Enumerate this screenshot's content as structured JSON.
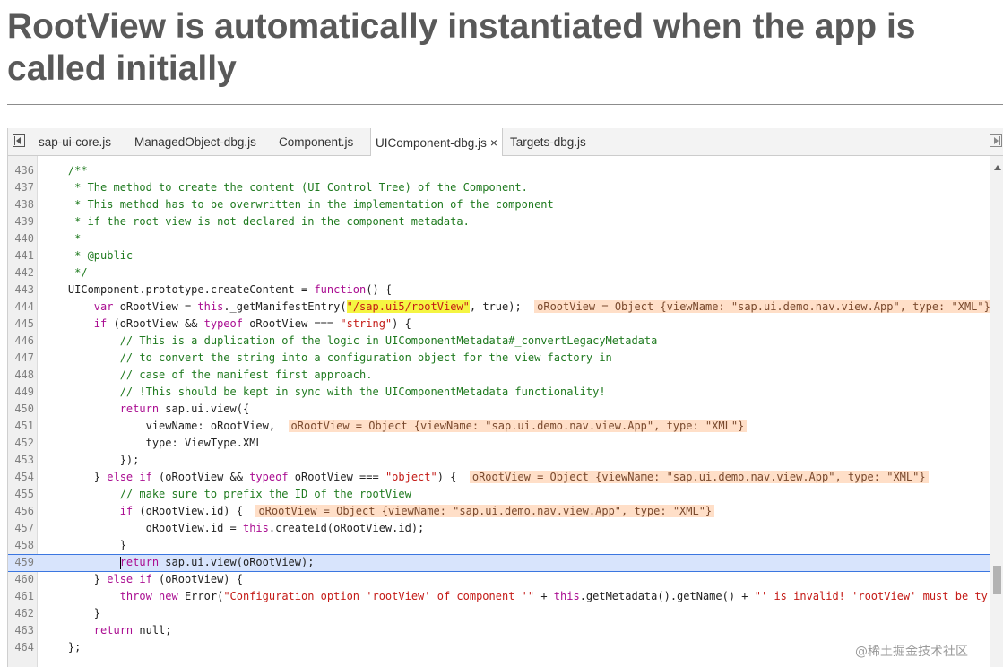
{
  "slide": {
    "title": "RootView is automatically instantiated when the app is called initially"
  },
  "tabs": [
    {
      "label": "sap-ui-core.js",
      "active": false
    },
    {
      "label": "ManagedObject-dbg.js",
      "active": false
    },
    {
      "label": "Component.js",
      "active": false
    },
    {
      "label": "UIComponent-dbg.js",
      "active": true
    },
    {
      "label": "Targets-dbg.js",
      "active": false
    }
  ],
  "tab_close_glyph": "×",
  "icons": {
    "navigator_toggle": "sidebar-toggle-icon",
    "debugger_toggle": "debugger-pane-toggle-icon",
    "close": "close-icon",
    "scroll_up": "scroll-up-arrow-icon"
  },
  "colors": {
    "comment": "#1f7a1f",
    "keyword": "#aa0d91",
    "string": "#c41a16",
    "yellow_highlight": "#f5f542",
    "inline_value_bg": "#ffdfc8",
    "current_line_bg": "#d8e4fc"
  },
  "current_line": "459",
  "lines": [
    {
      "n": "436",
      "s": [
        {
          "t": "    /**",
          "c": "cm"
        }
      ]
    },
    {
      "n": "437",
      "s": [
        {
          "t": "     * The method to create the content (UI Control Tree) of the Component.",
          "c": "cm"
        }
      ]
    },
    {
      "n": "438",
      "s": [
        {
          "t": "     * This method has to be overwritten in the implementation of the component",
          "c": "cm"
        }
      ]
    },
    {
      "n": "439",
      "s": [
        {
          "t": "     * if the root view is not declared in the component metadata.",
          "c": "cm"
        }
      ]
    },
    {
      "n": "440",
      "s": [
        {
          "t": "     *",
          "c": "cm"
        }
      ]
    },
    {
      "n": "441",
      "s": [
        {
          "t": "     * @public",
          "c": "cm"
        }
      ]
    },
    {
      "n": "442",
      "s": [
        {
          "t": "     */",
          "c": "cm"
        }
      ]
    },
    {
      "n": "443",
      "s": [
        {
          "t": "    UIComponent.prototype.createContent = "
        },
        {
          "t": "function",
          "c": "kw"
        },
        {
          "t": "() {"
        }
      ]
    },
    {
      "n": "444",
      "s": [
        {
          "t": "        "
        },
        {
          "t": "var",
          "c": "kw"
        },
        {
          "t": " oRootView = "
        },
        {
          "t": "this",
          "c": "kw"
        },
        {
          "t": "._getManifestEntry("
        },
        {
          "t": "\"/sap.ui5/rootView\"",
          "c": "st hl-yellow"
        },
        {
          "t": ", true);  "
        },
        {
          "t": "oRootView = Object {viewName: \"sap.ui.demo.nav.view.App\", type: \"XML\"}",
          "c": "inline-val"
        }
      ]
    },
    {
      "n": "445",
      "s": [
        {
          "t": "        "
        },
        {
          "t": "if",
          "c": "kw"
        },
        {
          "t": " (oRootView && "
        },
        {
          "t": "typeof",
          "c": "kw"
        },
        {
          "t": " oRootView === "
        },
        {
          "t": "\"string\"",
          "c": "st"
        },
        {
          "t": ") {"
        }
      ]
    },
    {
      "n": "446",
      "s": [
        {
          "t": "            // This is a duplication of the logic in UIComponentMetadata#_convertLegacyMetadata",
          "c": "cm"
        }
      ]
    },
    {
      "n": "447",
      "s": [
        {
          "t": "            // to convert the string into a configuration object for the view factory in",
          "c": "cm"
        }
      ]
    },
    {
      "n": "448",
      "s": [
        {
          "t": "            // case of the manifest first approach.",
          "c": "cm"
        }
      ]
    },
    {
      "n": "449",
      "s": [
        {
          "t": "            // !This should be kept in sync with the UIComponentMetadata functionality!",
          "c": "cm"
        }
      ]
    },
    {
      "n": "450",
      "s": [
        {
          "t": "            "
        },
        {
          "t": "return",
          "c": "kw"
        },
        {
          "t": " sap.ui.view({"
        }
      ]
    },
    {
      "n": "451",
      "s": [
        {
          "t": "                viewName: oRootView,  "
        },
        {
          "t": "oRootView = Object {viewName: \"sap.ui.demo.nav.view.App\", type: \"XML\"}",
          "c": "inline-val"
        }
      ]
    },
    {
      "n": "452",
      "s": [
        {
          "t": "                type: ViewType.XML"
        }
      ]
    },
    {
      "n": "453",
      "s": [
        {
          "t": "            });"
        }
      ]
    },
    {
      "n": "454",
      "s": [
        {
          "t": "        } "
        },
        {
          "t": "else if",
          "c": "kw"
        },
        {
          "t": " (oRootView && "
        },
        {
          "t": "typeof",
          "c": "kw"
        },
        {
          "t": " oRootView === "
        },
        {
          "t": "\"object\"",
          "c": "st"
        },
        {
          "t": ") {  "
        },
        {
          "t": "oRootView = Object {viewName: \"sap.ui.demo.nav.view.App\", type: \"XML\"}",
          "c": "inline-val"
        }
      ]
    },
    {
      "n": "455",
      "s": [
        {
          "t": "            // make sure to prefix the ID of the rootView",
          "c": "cm"
        }
      ]
    },
    {
      "n": "456",
      "s": [
        {
          "t": "            "
        },
        {
          "t": "if",
          "c": "kw"
        },
        {
          "t": " (oRootView.id) {  "
        },
        {
          "t": "oRootView = Object {viewName: \"sap.ui.demo.nav.view.App\", type: \"XML\"}",
          "c": "inline-val"
        }
      ]
    },
    {
      "n": "457",
      "s": [
        {
          "t": "                oRootView.id = "
        },
        {
          "t": "this",
          "c": "kw"
        },
        {
          "t": ".createId(oRootView.id);"
        }
      ]
    },
    {
      "n": "458",
      "s": [
        {
          "t": "            }"
        }
      ]
    },
    {
      "n": "459",
      "s": [
        {
          "t": "            "
        },
        {
          "t": "",
          "c": "caret"
        },
        {
          "t": "return",
          "c": "kw"
        },
        {
          "t": " sap.ui.view(oRootView);"
        }
      ]
    },
    {
      "n": "460",
      "s": [
        {
          "t": "        } "
        },
        {
          "t": "else if",
          "c": "kw"
        },
        {
          "t": " (oRootView) {"
        }
      ]
    },
    {
      "n": "461",
      "s": [
        {
          "t": "            "
        },
        {
          "t": "throw new",
          "c": "kw"
        },
        {
          "t": " Error("
        },
        {
          "t": "\"Configuration option 'rootView' of component '\"",
          "c": "st"
        },
        {
          "t": " + "
        },
        {
          "t": "this",
          "c": "kw"
        },
        {
          "t": ".getMetadata().getName() + "
        },
        {
          "t": "\"' is invalid! 'rootView' must be ty",
          "c": "st"
        }
      ]
    },
    {
      "n": "462",
      "s": [
        {
          "t": "        }"
        }
      ]
    },
    {
      "n": "463",
      "s": [
        {
          "t": "        "
        },
        {
          "t": "return",
          "c": "kw"
        },
        {
          "t": " null;"
        }
      ]
    },
    {
      "n": "464",
      "s": [
        {
          "t": "    };"
        }
      ]
    }
  ],
  "watermark": "@稀土掘金技术社区"
}
